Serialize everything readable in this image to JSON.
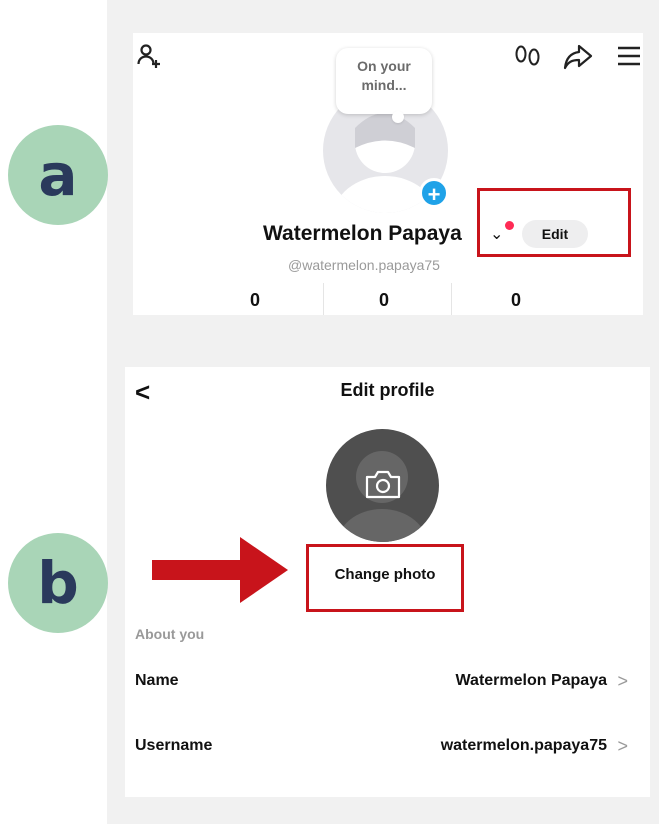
{
  "steps": {
    "a": "a",
    "b": "b"
  },
  "profile_screen": {
    "icons": [
      "add-friend-icon",
      "footprints-icon",
      "share-icon",
      "menu-icon"
    ],
    "bubble_line1": "On your",
    "bubble_line2": "mind...",
    "plus_badge": "+",
    "display_name": "Watermelon Papaya",
    "dropdown_symbol": "⌄",
    "edit_label": "Edit",
    "handle": "@watermelon.papaya75",
    "stats": [
      "0",
      "0",
      "0"
    ]
  },
  "edit_screen": {
    "back_symbol": "<",
    "title": "Edit profile",
    "change_photo_label": "Change photo",
    "section_label": "About you",
    "rows": [
      {
        "label": "Name",
        "value": "Watermelon Papaya",
        "chevron": ">"
      },
      {
        "label": "Username",
        "value": "watermelon.papaya75",
        "chevron": ">"
      }
    ]
  },
  "colors": {
    "badge_bg": "#a9d5b7",
    "badge_text": "#2a3a5c",
    "highlight": "#c8141b",
    "accent_blue": "#1fa2e8",
    "notification_dot": "#ff2b55",
    "panel_gray": "#f1f1f1"
  }
}
